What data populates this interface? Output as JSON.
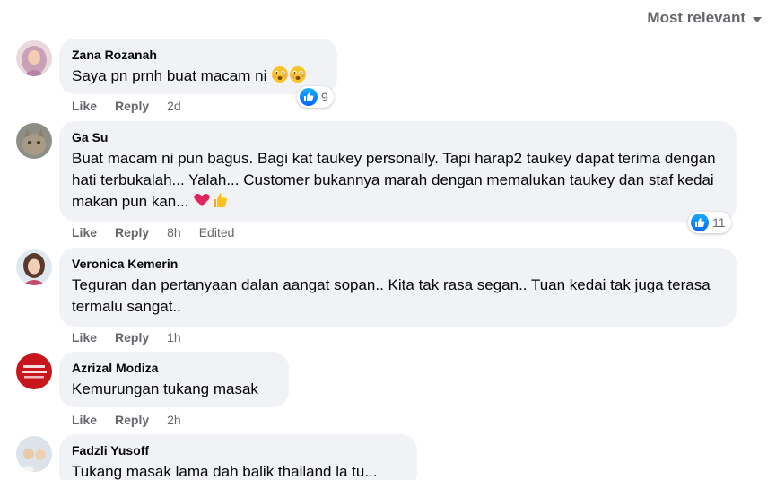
{
  "sort": {
    "label": "Most relevant"
  },
  "actions": {
    "like": "Like",
    "reply": "Reply"
  },
  "comments": [
    {
      "author": "Zana Rozanah",
      "text": "Saya pn prnh buat macam ni",
      "time": "2d",
      "reactions": "9",
      "edited": ""
    },
    {
      "author": "Ga Su",
      "text": "Buat macam ni pun bagus. Bagi kat taukey personally. Tapi harap2 taukey dapat terima dengan hati terbukalah... Yalah... Customer bukannya marah dengan memalukan taukey dan staf kedai makan pun kan...",
      "time": "8h",
      "reactions": "11",
      "edited": "Edited"
    },
    {
      "author": "Veronica Kemerin",
      "text": "Teguran dan pertanyaan dalan aangat sopan.. Kita tak rasa segan.. Tuan kedai tak juga terasa termalu sangat..",
      "time": "1h",
      "reactions": "",
      "edited": ""
    },
    {
      "author": "Azrizal Modiza",
      "text": "Kemurungan tukang masak",
      "time": "2h",
      "reactions": "",
      "edited": ""
    },
    {
      "author": "Fadzli Yusoff",
      "text": "Tukang masak lama dah balik thailand la tu...",
      "time": "",
      "reactions": "",
      "edited": ""
    }
  ]
}
